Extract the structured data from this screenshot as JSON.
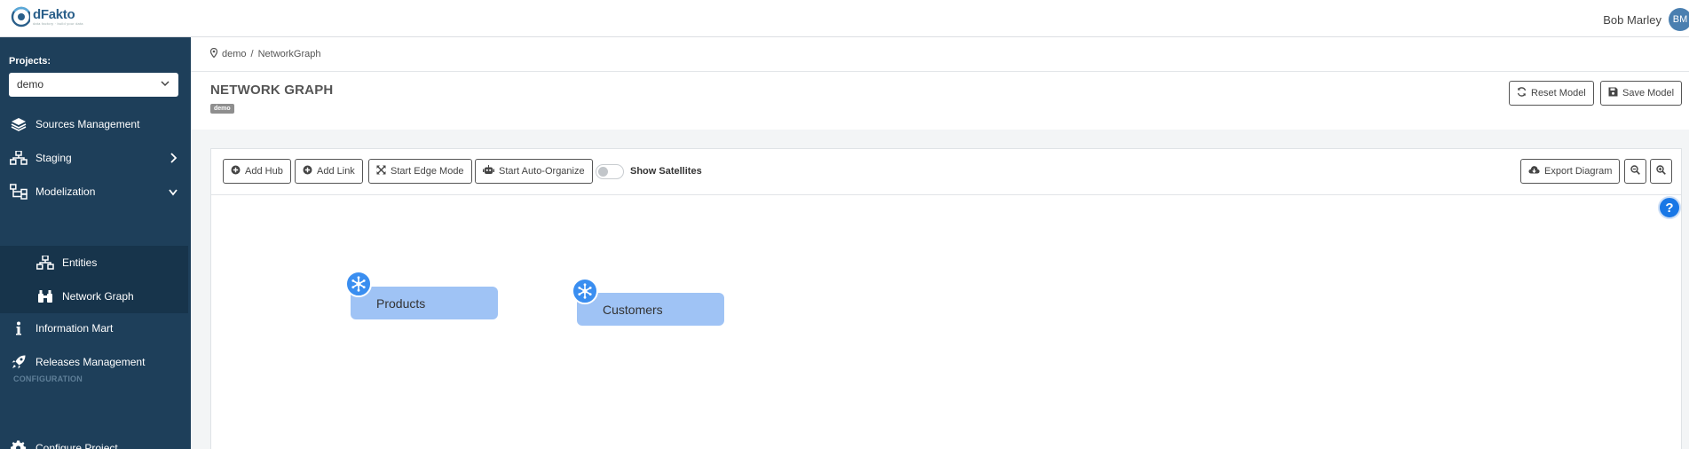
{
  "app": {
    "name": "dFakto",
    "tagline": "data factory · build your data"
  },
  "user": {
    "name": "Bob Marley",
    "initials": "BM"
  },
  "sidebar": {
    "projects_label": "Projects:",
    "project_value": "demo",
    "items": [
      {
        "label": "Sources Management",
        "icon": "layers-icon"
      },
      {
        "label": "Staging",
        "icon": "sitemap-icon"
      },
      {
        "label": "Modelization",
        "icon": "hierarchy-icon"
      },
      {
        "label": "Entities",
        "icon": "sitemap-icon"
      },
      {
        "label": "Network Graph",
        "icon": "binoculars-icon"
      },
      {
        "label": "Information Mart",
        "icon": "info-icon"
      },
      {
        "label": "Releases Management",
        "icon": "rocket-icon"
      },
      {
        "label": "Configure Project",
        "icon": "gear-icon"
      }
    ],
    "section_configuration": "CONFIGURATION"
  },
  "breadcrumb": {
    "items": [
      "demo",
      "NetworkGraph"
    ],
    "separator": "/"
  },
  "page": {
    "title": "NETWORK GRAPH",
    "badge": "demo"
  },
  "actions": {
    "reset": "Reset Model",
    "save": "Save Model"
  },
  "toolbar": {
    "add_hub": "Add Hub",
    "add_link": "Add Link",
    "edge_mode": "Start Edge Mode",
    "auto_organize": "Start Auto-Organize",
    "show_satellites": "Show Satellites",
    "show_satellites_on": false,
    "export": "Export Diagram"
  },
  "graph": {
    "nodes": [
      {
        "label": "Products",
        "icon": "hub-icon"
      },
      {
        "label": "Customers",
        "icon": "hub-icon"
      }
    ]
  },
  "help": "?",
  "colors": {
    "sidebar": "#1e3f5a",
    "sidebar_sub": "#17344b",
    "node_fill": "#9fc3f5",
    "node_icon": "#3a8ef0",
    "help": "#1877e6"
  }
}
